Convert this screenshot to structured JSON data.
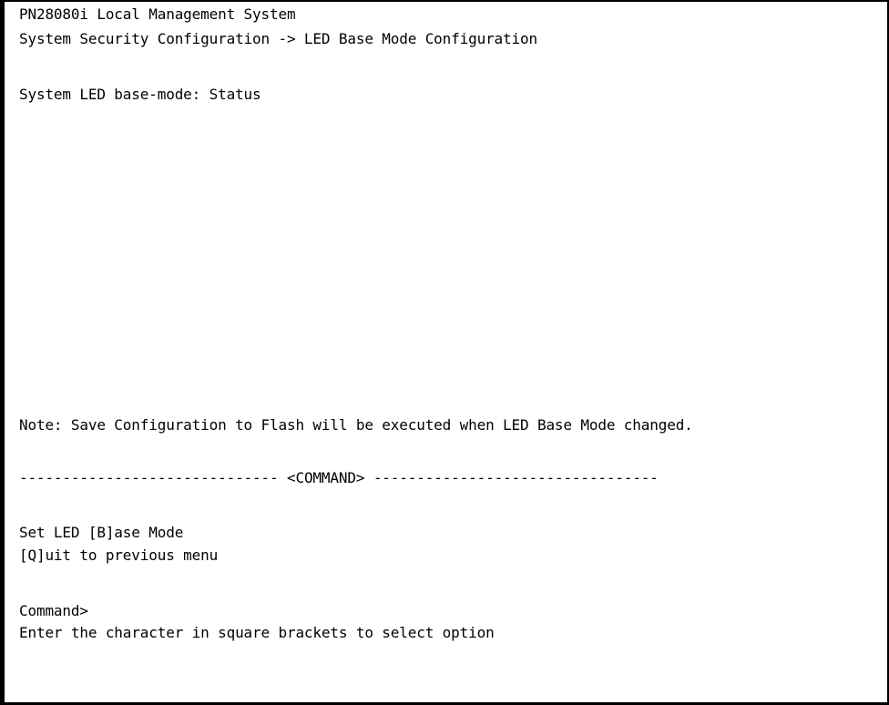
{
  "header": {
    "system_name": "PN28080i Local Management System",
    "breadcrumb": "System Security Configuration -> LED Base Mode Configuration"
  },
  "status": {
    "label": "System LED base-mode:",
    "value": "Status"
  },
  "note": "Note: Save Configuration to Flash will be executed when LED Base Mode changed.",
  "command_section": {
    "divider_left": "------------------------------",
    "divider_title": "<COMMAND>",
    "divider_right": "---------------------------------",
    "items": [
      {
        "label": "Set LED [B]ase Mode",
        "key": "B"
      },
      {
        "label": "[Q]uit to previous menu",
        "key": "Q"
      }
    ]
  },
  "prompt": {
    "label": "Command>",
    "input_value": "",
    "hint": "Enter the character in square brackets to select option"
  },
  "colors": {
    "background": "#ffffff",
    "text": "#000000",
    "border": "#000000"
  }
}
